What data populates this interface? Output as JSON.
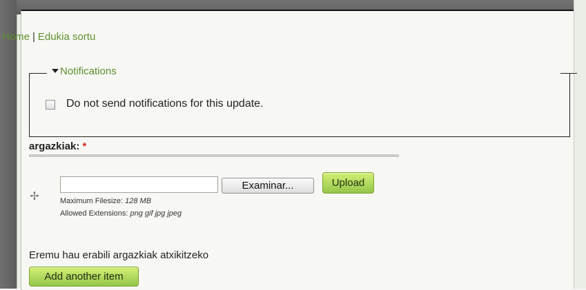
{
  "breadcrumb": {
    "home": "Home",
    "separator": "|",
    "current": "Edukia sortu"
  },
  "notifications": {
    "legend": "Notifications",
    "checkbox_label": "Do not send notifications for this update.",
    "checked": false
  },
  "field": {
    "title": "argazkiak:",
    "required_marker": "*",
    "browse_label": "Examinar...",
    "upload_label": "Upload",
    "max_filesize_label": "Maximum Filesize:",
    "max_filesize_value": "128 MB",
    "extensions_label": "Allowed Extensions:",
    "extensions_value": "png gif jpg jpeg",
    "description": "Eremu hau erabili argazkiak atxikitzeko",
    "add_button": "Add another item"
  },
  "colors": {
    "link_green": "#5d8f2d",
    "button_green": "#a8d45b",
    "required_red": "#d22222"
  },
  "icons": {
    "legend_toggle": "triangle-down-icon",
    "drag_handle": "move-cross-icon"
  }
}
